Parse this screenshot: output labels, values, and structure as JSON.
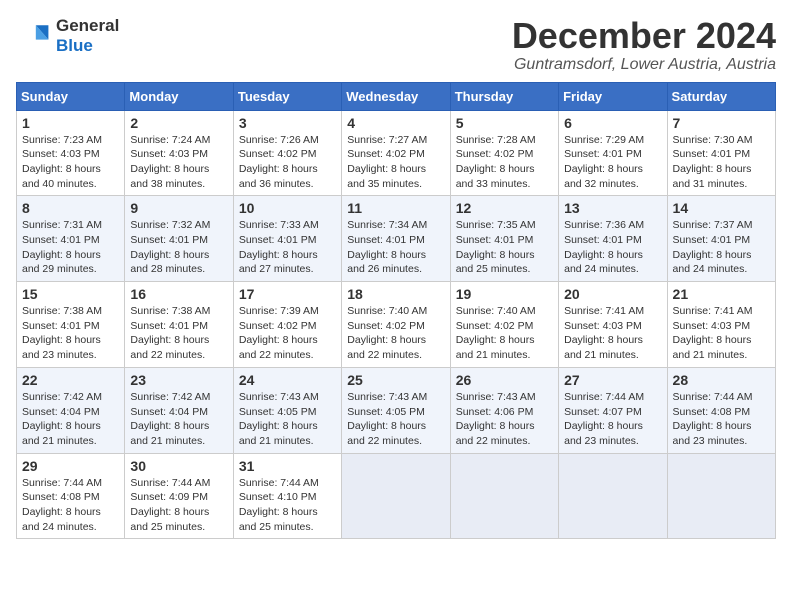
{
  "header": {
    "logo_line1": "General",
    "logo_line2": "Blue",
    "month": "December 2024",
    "location": "Guntramsdorf, Lower Austria, Austria"
  },
  "weekdays": [
    "Sunday",
    "Monday",
    "Tuesday",
    "Wednesday",
    "Thursday",
    "Friday",
    "Saturday"
  ],
  "weeks": [
    [
      {
        "day": "1",
        "sunrise": "Sunrise: 7:23 AM",
        "sunset": "Sunset: 4:03 PM",
        "daylight": "Daylight: 8 hours and 40 minutes."
      },
      {
        "day": "2",
        "sunrise": "Sunrise: 7:24 AM",
        "sunset": "Sunset: 4:03 PM",
        "daylight": "Daylight: 8 hours and 38 minutes."
      },
      {
        "day": "3",
        "sunrise": "Sunrise: 7:26 AM",
        "sunset": "Sunset: 4:02 PM",
        "daylight": "Daylight: 8 hours and 36 minutes."
      },
      {
        "day": "4",
        "sunrise": "Sunrise: 7:27 AM",
        "sunset": "Sunset: 4:02 PM",
        "daylight": "Daylight: 8 hours and 35 minutes."
      },
      {
        "day": "5",
        "sunrise": "Sunrise: 7:28 AM",
        "sunset": "Sunset: 4:02 PM",
        "daylight": "Daylight: 8 hours and 33 minutes."
      },
      {
        "day": "6",
        "sunrise": "Sunrise: 7:29 AM",
        "sunset": "Sunset: 4:01 PM",
        "daylight": "Daylight: 8 hours and 32 minutes."
      },
      {
        "day": "7",
        "sunrise": "Sunrise: 7:30 AM",
        "sunset": "Sunset: 4:01 PM",
        "daylight": "Daylight: 8 hours and 31 minutes."
      }
    ],
    [
      {
        "day": "8",
        "sunrise": "Sunrise: 7:31 AM",
        "sunset": "Sunset: 4:01 PM",
        "daylight": "Daylight: 8 hours and 29 minutes."
      },
      {
        "day": "9",
        "sunrise": "Sunrise: 7:32 AM",
        "sunset": "Sunset: 4:01 PM",
        "daylight": "Daylight: 8 hours and 28 minutes."
      },
      {
        "day": "10",
        "sunrise": "Sunrise: 7:33 AM",
        "sunset": "Sunset: 4:01 PM",
        "daylight": "Daylight: 8 hours and 27 minutes."
      },
      {
        "day": "11",
        "sunrise": "Sunrise: 7:34 AM",
        "sunset": "Sunset: 4:01 PM",
        "daylight": "Daylight: 8 hours and 26 minutes."
      },
      {
        "day": "12",
        "sunrise": "Sunrise: 7:35 AM",
        "sunset": "Sunset: 4:01 PM",
        "daylight": "Daylight: 8 hours and 25 minutes."
      },
      {
        "day": "13",
        "sunrise": "Sunrise: 7:36 AM",
        "sunset": "Sunset: 4:01 PM",
        "daylight": "Daylight: 8 hours and 24 minutes."
      },
      {
        "day": "14",
        "sunrise": "Sunrise: 7:37 AM",
        "sunset": "Sunset: 4:01 PM",
        "daylight": "Daylight: 8 hours and 24 minutes."
      }
    ],
    [
      {
        "day": "15",
        "sunrise": "Sunrise: 7:38 AM",
        "sunset": "Sunset: 4:01 PM",
        "daylight": "Daylight: 8 hours and 23 minutes."
      },
      {
        "day": "16",
        "sunrise": "Sunrise: 7:38 AM",
        "sunset": "Sunset: 4:01 PM",
        "daylight": "Daylight: 8 hours and 22 minutes."
      },
      {
        "day": "17",
        "sunrise": "Sunrise: 7:39 AM",
        "sunset": "Sunset: 4:02 PM",
        "daylight": "Daylight: 8 hours and 22 minutes."
      },
      {
        "day": "18",
        "sunrise": "Sunrise: 7:40 AM",
        "sunset": "Sunset: 4:02 PM",
        "daylight": "Daylight: 8 hours and 22 minutes."
      },
      {
        "day": "19",
        "sunrise": "Sunrise: 7:40 AM",
        "sunset": "Sunset: 4:02 PM",
        "daylight": "Daylight: 8 hours and 21 minutes."
      },
      {
        "day": "20",
        "sunrise": "Sunrise: 7:41 AM",
        "sunset": "Sunset: 4:03 PM",
        "daylight": "Daylight: 8 hours and 21 minutes."
      },
      {
        "day": "21",
        "sunrise": "Sunrise: 7:41 AM",
        "sunset": "Sunset: 4:03 PM",
        "daylight": "Daylight: 8 hours and 21 minutes."
      }
    ],
    [
      {
        "day": "22",
        "sunrise": "Sunrise: 7:42 AM",
        "sunset": "Sunset: 4:04 PM",
        "daylight": "Daylight: 8 hours and 21 minutes."
      },
      {
        "day": "23",
        "sunrise": "Sunrise: 7:42 AM",
        "sunset": "Sunset: 4:04 PM",
        "daylight": "Daylight: 8 hours and 21 minutes."
      },
      {
        "day": "24",
        "sunrise": "Sunrise: 7:43 AM",
        "sunset": "Sunset: 4:05 PM",
        "daylight": "Daylight: 8 hours and 21 minutes."
      },
      {
        "day": "25",
        "sunrise": "Sunrise: 7:43 AM",
        "sunset": "Sunset: 4:05 PM",
        "daylight": "Daylight: 8 hours and 22 minutes."
      },
      {
        "day": "26",
        "sunrise": "Sunrise: 7:43 AM",
        "sunset": "Sunset: 4:06 PM",
        "daylight": "Daylight: 8 hours and 22 minutes."
      },
      {
        "day": "27",
        "sunrise": "Sunrise: 7:44 AM",
        "sunset": "Sunset: 4:07 PM",
        "daylight": "Daylight: 8 hours and 23 minutes."
      },
      {
        "day": "28",
        "sunrise": "Sunrise: 7:44 AM",
        "sunset": "Sunset: 4:08 PM",
        "daylight": "Daylight: 8 hours and 23 minutes."
      }
    ],
    [
      {
        "day": "29",
        "sunrise": "Sunrise: 7:44 AM",
        "sunset": "Sunset: 4:08 PM",
        "daylight": "Daylight: 8 hours and 24 minutes."
      },
      {
        "day": "30",
        "sunrise": "Sunrise: 7:44 AM",
        "sunset": "Sunset: 4:09 PM",
        "daylight": "Daylight: 8 hours and 25 minutes."
      },
      {
        "day": "31",
        "sunrise": "Sunrise: 7:44 AM",
        "sunset": "Sunset: 4:10 PM",
        "daylight": "Daylight: 8 hours and 25 minutes."
      },
      null,
      null,
      null,
      null
    ]
  ]
}
